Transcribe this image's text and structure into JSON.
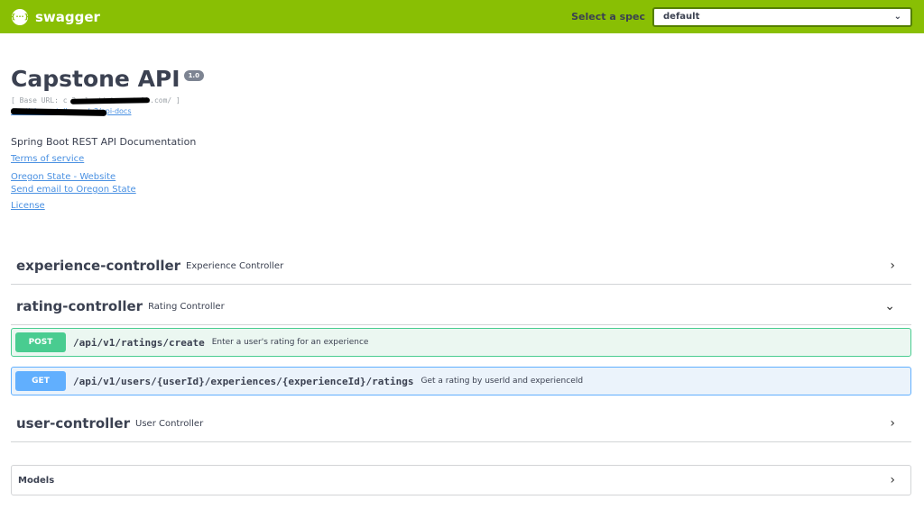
{
  "topbar": {
    "brand_logo": "{···}",
    "brand": "swagger",
    "spec_label": "Select a spec",
    "spec_value": "default",
    "select_chevron": "⌄"
  },
  "info": {
    "title": "Capstone API",
    "version": "1.0",
    "base_url": "[ Base URL: c               2.elasticbeanstalk.com/ ]",
    "spec_url": "                  elasticbeanstalk.com/v2/api-docs",
    "description": "Spring Boot REST API Documentation",
    "terms": "Terms of service",
    "website": "Oregon State - Website",
    "email": "Send email to Oregon State",
    "license": "License"
  },
  "controllers": [
    {
      "name": "experience-controller",
      "desc": "Experience Controller",
      "arrow": "›"
    },
    {
      "name": "rating-controller",
      "desc": "Rating Controller",
      "arrow": "⌄"
    },
    {
      "name": "user-controller",
      "desc": "User Controller",
      "arrow": "›"
    }
  ],
  "operations": [
    {
      "method": "POST",
      "path": "/api/v1/ratings/create",
      "summary": "Enter a user's rating for an experience"
    },
    {
      "method": "GET",
      "path": "/api/v1/users/{userId}/experiences/{experienceId}/ratings",
      "summary": "Get a rating by userId and experienceId"
    }
  ],
  "models": {
    "label": "Models",
    "arrow": "›"
  },
  "colors": {
    "topbar": "#89bf04",
    "post": "#49cc90",
    "get": "#61affe",
    "link": "#4990e2"
  }
}
